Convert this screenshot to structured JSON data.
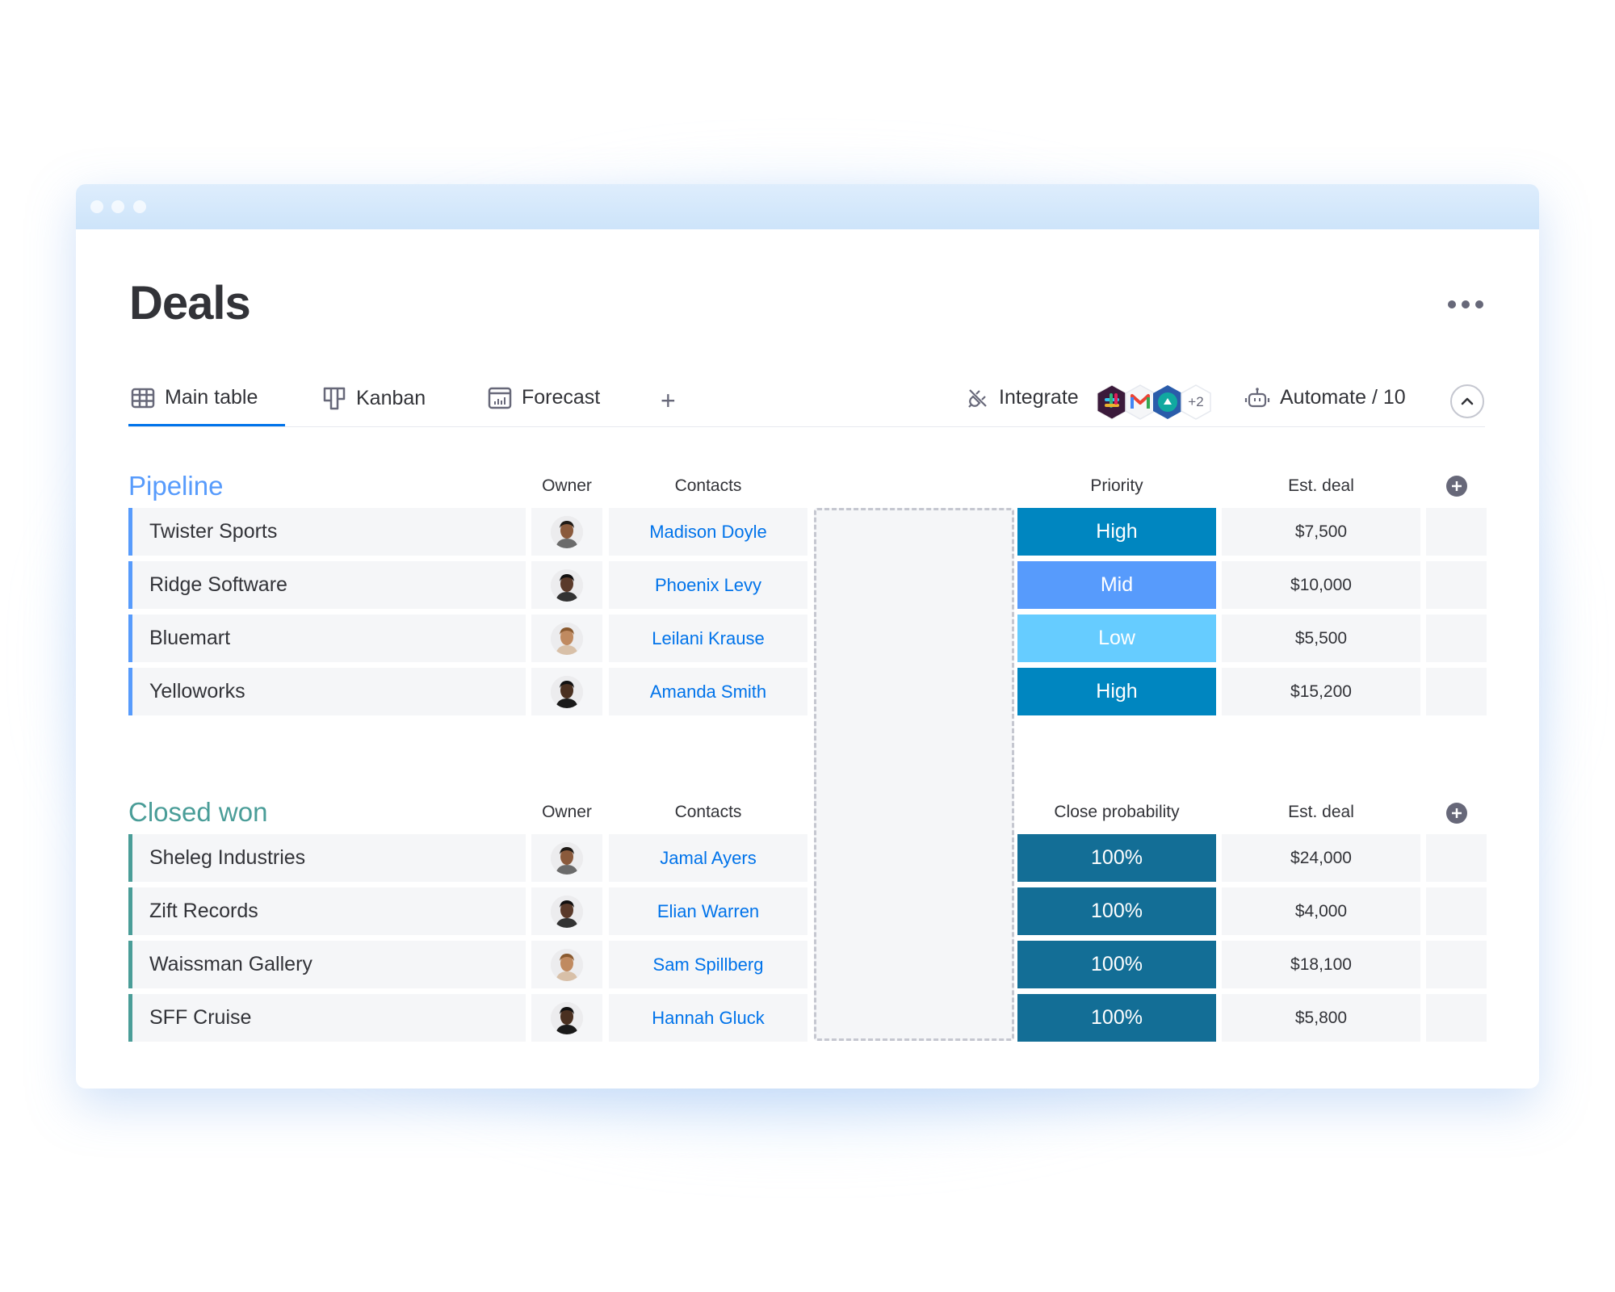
{
  "board": {
    "title": "Deals",
    "more_label": "More options"
  },
  "tabs": [
    {
      "label": "Main table",
      "icon": "table-icon",
      "active": true
    },
    {
      "label": "Kanban",
      "icon": "kanban-icon",
      "active": false
    },
    {
      "label": "Forecast",
      "icon": "chart-icon",
      "active": false
    }
  ],
  "toolbar": {
    "add_view_label": "+",
    "integrate_label": "Integrate",
    "integrations": [
      "slack",
      "gmail",
      "app"
    ],
    "integrations_more": "+2",
    "automate_label": "Automate / 10"
  },
  "colors": {
    "accent": "#0073ea",
    "pipeline_group": "#579bfc",
    "closed_group": "#4a9d98",
    "high": "#0086c0",
    "mid": "#579bfc",
    "low": "#66ccff",
    "prob": "#136e96"
  },
  "groups": [
    {
      "title": "Pipeline",
      "columns": {
        "owner": "Owner",
        "contacts": "Contacts",
        "status": "Priority",
        "deal": "Est. deal"
      },
      "rows": [
        {
          "name": "Twister Sports",
          "owner": "man-1",
          "contact": "Madison Doyle",
          "status": "High",
          "deal": "$7,500"
        },
        {
          "name": "Ridge Software",
          "owner": "woman-1",
          "contact": "Phoenix Levy",
          "status": "Mid",
          "deal": "$10,000"
        },
        {
          "name": "Bluemart",
          "owner": "woman-2",
          "contact": "Leilani Krause",
          "status": "Low",
          "deal": "$5,500"
        },
        {
          "name": "Yelloworks",
          "owner": "man-2",
          "contact": "Amanda Smith",
          "status": "High",
          "deal": "$15,200"
        }
      ]
    },
    {
      "title": "Closed won",
      "columns": {
        "owner": "Owner",
        "contacts": "Contacts",
        "status": "Close probability",
        "deal": "Est. deal"
      },
      "rows": [
        {
          "name": "Sheleg Industries",
          "owner": "man-1",
          "contact": "Jamal Ayers",
          "status": "100%",
          "deal": "$24,000"
        },
        {
          "name": "Zift Records",
          "owner": "woman-1",
          "contact": "Elian Warren",
          "status": "100%",
          "deal": "$4,000"
        },
        {
          "name": "Waissman Gallery",
          "owner": "woman-2",
          "contact": "Sam Spillberg",
          "status": "100%",
          "deal": "$18,100"
        },
        {
          "name": "SFF Cruise",
          "owner": "man-2",
          "contact": "Hannah Gluck",
          "status": "100%",
          "deal": "$5,800"
        }
      ]
    }
  ]
}
